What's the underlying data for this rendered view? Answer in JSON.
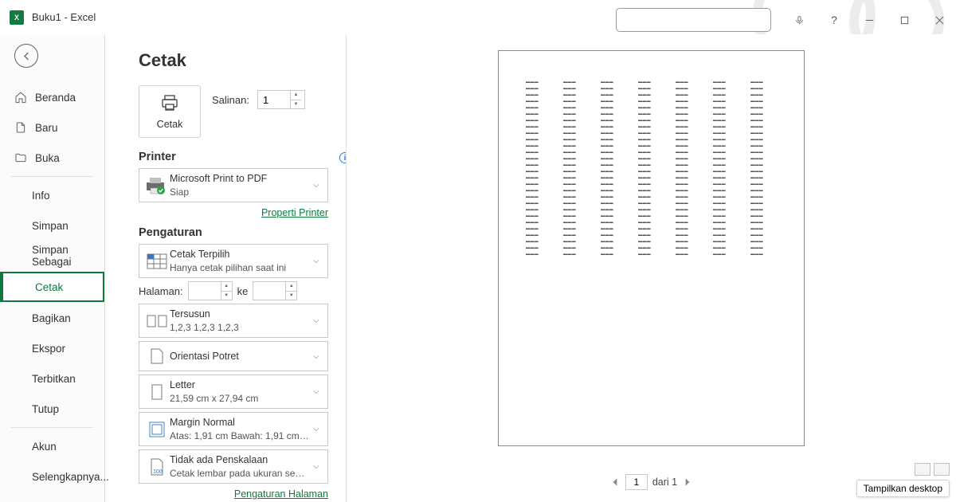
{
  "titlebar": {
    "app": "X",
    "title": "Buku1  -  Excel"
  },
  "sidebar": {
    "items": [
      {
        "id": "home",
        "label": "Beranda"
      },
      {
        "id": "new",
        "label": "Baru"
      },
      {
        "id": "open",
        "label": "Buka"
      },
      {
        "id": "info",
        "label": "Info"
      },
      {
        "id": "save",
        "label": "Simpan"
      },
      {
        "id": "saveas",
        "label": "Simpan Sebagai"
      },
      {
        "id": "print",
        "label": "Cetak"
      },
      {
        "id": "share",
        "label": "Bagikan"
      },
      {
        "id": "export",
        "label": "Ekspor"
      },
      {
        "id": "publish",
        "label": "Terbitkan"
      },
      {
        "id": "close",
        "label": "Tutup"
      },
      {
        "id": "account",
        "label": "Akun"
      },
      {
        "id": "more",
        "label": "Selengkapnya..."
      }
    ]
  },
  "print": {
    "title": "Cetak",
    "button_label": "Cetak",
    "copies_label": "Salinan:",
    "copies_value": "1",
    "printer_header": "Printer",
    "printer_name": "Microsoft Print to PDF",
    "printer_status": "Siap",
    "printer_props_link": "Properti Printer",
    "settings_header": "Pengaturan",
    "print_area": {
      "title": "Cetak Terpilih",
      "sub": "Hanya cetak pilihan saat ini"
    },
    "pages_label": "Halaman:",
    "pages_to": "ke",
    "collation": {
      "title": "Tersusun",
      "sub": "1,2,3    1,2,3    1,2,3"
    },
    "orientation": {
      "title": "Orientasi Potret"
    },
    "paper": {
      "title": "Letter",
      "sub": "21,59 cm x 27,94 cm"
    },
    "margins": {
      "title": "Margin Normal",
      "sub": "Atas: 1,91 cm Bawah: 1,91 cm…"
    },
    "scaling": {
      "title": "Tidak ada Penskalaan",
      "sub": "Cetak lembar pada ukuran se…"
    },
    "page_setup_link": "Pengaturan Halaman"
  },
  "preview": {
    "current_page": "1",
    "of_label": "dari 1",
    "desktop_btn": "Tampilkan desktop"
  }
}
